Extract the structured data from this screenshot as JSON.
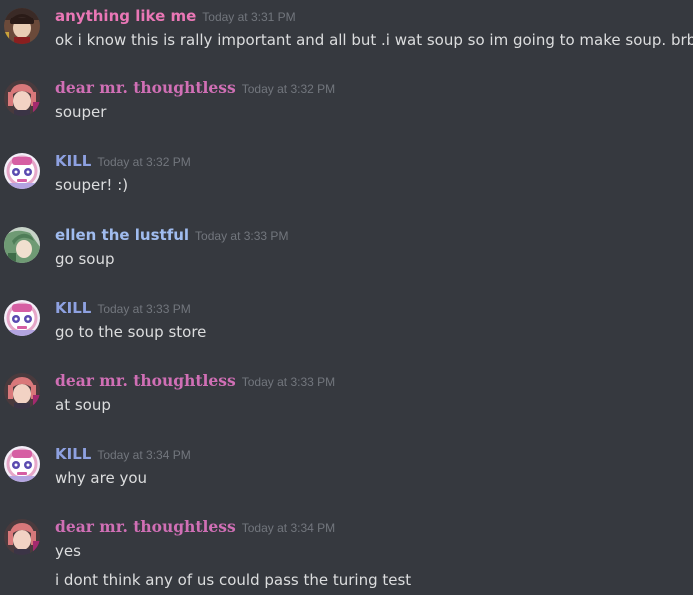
{
  "messages": [
    {
      "author": "anything like me",
      "author_color": "#ea77b6",
      "timestamp": "Today at 3:31 PM",
      "avatar": "dark-hair-avatar-icon",
      "lines": [
        "ok i know this is rally important and all but .i wat soup so im going to make soup. brb"
      ]
    },
    {
      "author": "dear mr. thoughtless",
      "author_color": "#d06fb5",
      "timestamp": "Today at 3:32 PM",
      "avatar": "pink-hair-avatar-icon",
      "lines": [
        "souper"
      ]
    },
    {
      "author": "KILL",
      "author_color": "#8ea1e1",
      "timestamp": "Today at 3:32 PM",
      "avatar": "purple-robot-avatar-icon",
      "lines": [
        "souper! :)"
      ]
    },
    {
      "author": "ellen the lustful",
      "author_color": "#a0bcef",
      "timestamp": "Today at 3:33 PM",
      "avatar": "green-hair-avatar-icon",
      "lines": [
        "go soup"
      ]
    },
    {
      "author": "KILL",
      "author_color": "#8ea1e1",
      "timestamp": "Today at 3:33 PM",
      "avatar": "purple-robot-avatar-icon",
      "lines": [
        "go to the soup store"
      ]
    },
    {
      "author": "dear mr. thoughtless",
      "author_color": "#d06fb5",
      "timestamp": "Today at 3:33 PM",
      "avatar": "pink-hair-avatar-icon",
      "lines": [
        "at soup"
      ]
    },
    {
      "author": "KILL",
      "author_color": "#8ea1e1",
      "timestamp": "Today at 3:34 PM",
      "avatar": "purple-robot-avatar-icon",
      "lines": [
        "why are you"
      ]
    },
    {
      "author": "dear mr. thoughtless",
      "author_color": "#d06fb5",
      "timestamp": "Today at 3:34 PM",
      "avatar": "pink-hair-avatar-icon",
      "lines": [
        "yes",
        "i dont think any of us could pass the turing test"
      ]
    }
  ],
  "colors": {
    "background": "#36393f",
    "message_text": "#dcddde",
    "timestamp": "#72767d"
  }
}
